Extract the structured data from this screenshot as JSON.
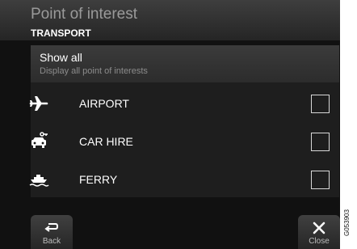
{
  "header": {
    "title": "Point of interest",
    "subtitle": "TRANSPORT"
  },
  "show_all": {
    "label": "Show all",
    "description": "Display all point of interests"
  },
  "items": [
    {
      "label": "AIRPORT",
      "icon": "airplane-icon",
      "checked": false
    },
    {
      "label": "CAR HIRE",
      "icon": "car-hire-icon",
      "checked": false
    },
    {
      "label": "FERRY",
      "icon": "ferry-icon",
      "checked": false
    }
  ],
  "footer": {
    "back_label": "Back",
    "back_icon": "back-arrow-icon",
    "close_label": "Close",
    "close_icon": "close-icon"
  },
  "image_code": "G053903"
}
